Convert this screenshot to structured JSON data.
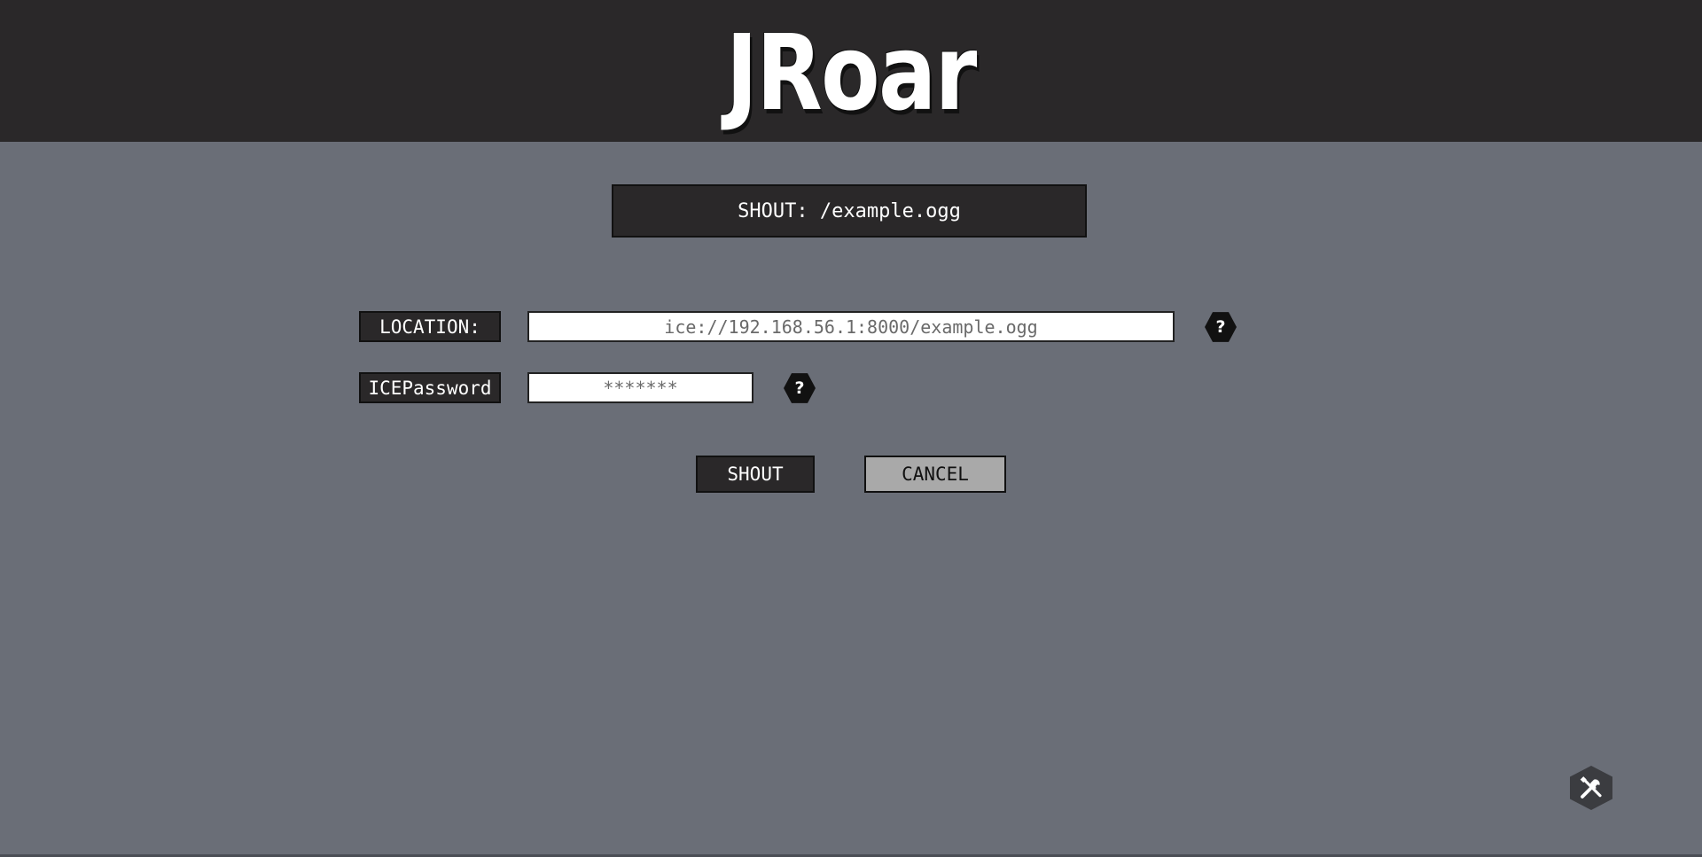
{
  "header": {
    "logo_text": "JRoar"
  },
  "title": {
    "text": "SHOUT: /example.ogg"
  },
  "form": {
    "location_label": "LOCATION:",
    "location_value": "ice://192.168.56.1:8000/example.ogg",
    "password_label": "ICEPassword",
    "password_value": "*******",
    "help_glyph": "?"
  },
  "buttons": {
    "shout_label": "SHOUT",
    "cancel_label": "CANCEL"
  },
  "icons": {
    "help": "question-icon",
    "tools": "tools-icon"
  },
  "colors": {
    "background": "#6a6e77",
    "header": "#2a2829",
    "cancel_button": "#a9a9a9"
  }
}
